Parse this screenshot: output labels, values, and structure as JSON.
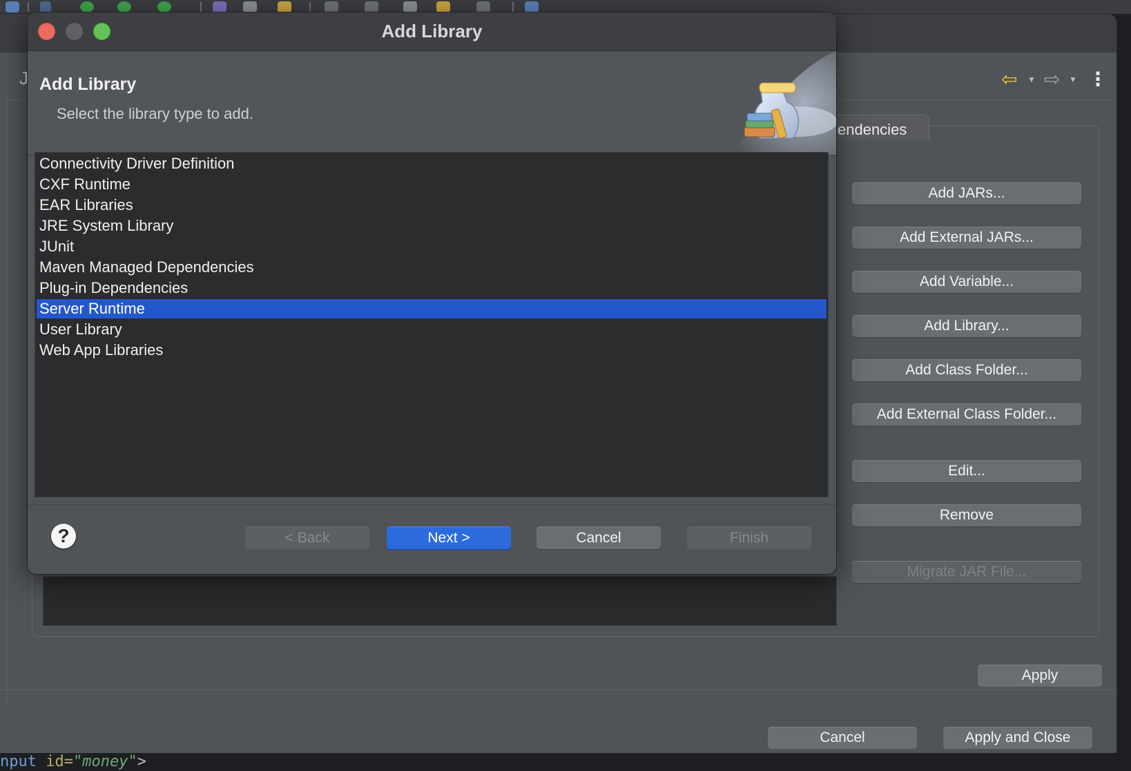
{
  "background_window": {
    "partial_letter": "J",
    "tab_label": "endencies",
    "side_buttons": [
      {
        "label": "Add JARs...",
        "enabled": true
      },
      {
        "label": "Add External JARs...",
        "enabled": true
      },
      {
        "label": "Add Variable...",
        "enabled": true
      },
      {
        "label": "Add Library...",
        "enabled": true
      },
      {
        "label": "Add Class Folder...",
        "enabled": true
      },
      {
        "label": "Add External Class Folder...",
        "enabled": true
      },
      {
        "label": "Edit...",
        "enabled": true
      },
      {
        "label": "Remove",
        "enabled": true
      },
      {
        "label": "Migrate JAR File...",
        "enabled": false
      }
    ],
    "apply_label": "Apply",
    "cancel_label": "Cancel",
    "apply_close_label": "Apply and Close",
    "nav": {
      "back_icon": "left-arrow-icon",
      "forward_icon": "right-arrow-icon",
      "menu_icon": "kebab-menu-icon"
    }
  },
  "dialog": {
    "window_title": "Add Library",
    "header_title": "Add Library",
    "header_subtitle": "Select the library type to add.",
    "banner_icon": "library-jar-books-icon",
    "libraries": [
      "Connectivity Driver Definition",
      "CXF Runtime",
      "EAR Libraries",
      "JRE System Library",
      "JUnit",
      "Maven Managed Dependencies",
      "Plug-in Dependencies",
      "Server Runtime",
      "User Library",
      "Web App Libraries"
    ],
    "selected_index": 7,
    "buttons": {
      "help_label": "?",
      "back_label": "< Back",
      "next_label": "Next >",
      "cancel_label": "Cancel",
      "finish_label": "Finish"
    }
  },
  "editor_snippet": {
    "tag": "nput",
    "attr": "id=",
    "value": "\"money\"",
    "close": ">"
  },
  "colors": {
    "selection": "#2357cc",
    "primary_button": "#2b6bdc",
    "traffic_red": "#ed6a5e",
    "traffic_green": "#61c454",
    "nav_back_arrow": "#f3c035"
  }
}
